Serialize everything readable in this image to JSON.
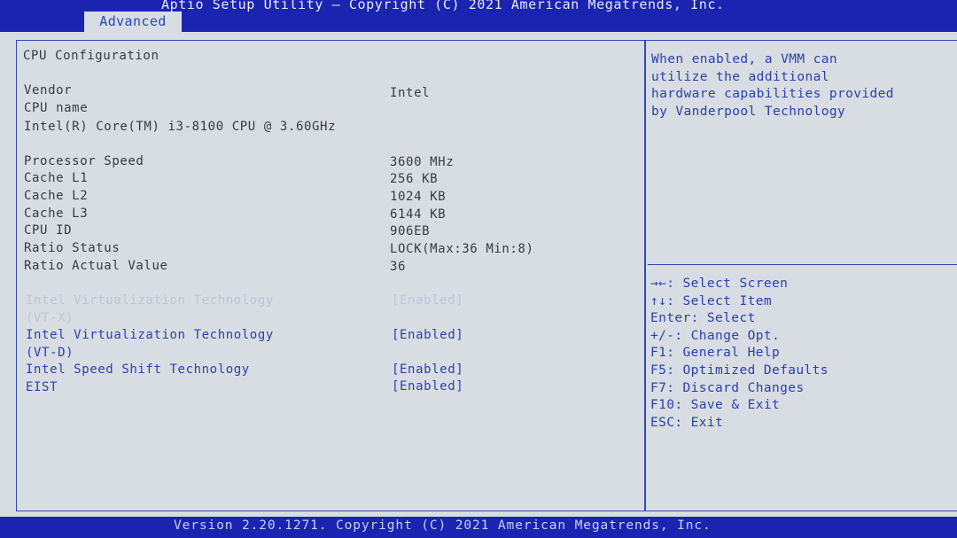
{
  "header": {
    "title": "Aptio Setup Utility – Copyright (C) 2021 American Megatrends, Inc.",
    "active_tab": "Advanced"
  },
  "main": {
    "section_title": "CPU Configuration",
    "info": [
      {
        "label": "Vendor",
        "value": "Intel"
      },
      {
        "label": "CPU name",
        "value": ""
      }
    ],
    "cpu_name": "Intel(R) Core(TM) i3-8100 CPU @ 3.60GHz",
    "specs": [
      {
        "label": "Processor Speed",
        "value": "3600 MHz"
      },
      {
        "label": "Cache L1",
        "value": "256 KB"
      },
      {
        "label": "Cache L2",
        "value": "1024 KB"
      },
      {
        "label": "Cache L3",
        "value": "6144 KB"
      },
      {
        "label": "CPU ID",
        "value": "906EB"
      },
      {
        "label": "Ratio Status",
        "value": "LOCK(Max:36 Min:8)"
      },
      {
        "label": "Ratio Actual Value",
        "value": "36"
      }
    ],
    "options": [
      {
        "label": "Intel Virtualization Technology",
        "label2": "(VT-X)",
        "value": "[Enabled]",
        "selected": true
      },
      {
        "label": "Intel Virtualization Technology",
        "label2": "(VT-D)",
        "value": "[Enabled]",
        "selected": false
      },
      {
        "label": "Intel Speed Shift Technology",
        "label2": "",
        "value": "[Enabled]",
        "selected": false
      },
      {
        "label": "EIST",
        "label2": "",
        "value": "[Enabled]",
        "selected": false
      }
    ]
  },
  "help": {
    "lines": [
      "When enabled, a VMM can",
      "utilize the additional",
      "hardware capabilities provided",
      "by Vanderpool Technology"
    ]
  },
  "keys": [
    {
      "key": "→←:",
      "desc": "Select Screen"
    },
    {
      "key": "↑↓:",
      "desc": "Select Item"
    },
    {
      "key": "Enter:",
      "desc": "Select"
    },
    {
      "key": "+/-:",
      "desc": "Change Opt."
    },
    {
      "key": "F1:",
      "desc": "General Help"
    },
    {
      "key": "F5:",
      "desc": "Optimized Defaults"
    },
    {
      "key": "F7:",
      "desc": "Discard Changes"
    },
    {
      "key": "F10:",
      "desc": "Save & Exit"
    },
    {
      "key": "ESC:",
      "desc": "Exit"
    }
  ],
  "footer": {
    "text": "Version 2.20.1271. Copyright (C) 2021 American Megatrends, Inc."
  },
  "colors": {
    "bar_blue": "#1a24b0",
    "panel_bg": "#d7dde2",
    "accent_blue": "#2e40ae",
    "text_dark": "#353c44",
    "highlight_faded": "#bcc6de"
  }
}
